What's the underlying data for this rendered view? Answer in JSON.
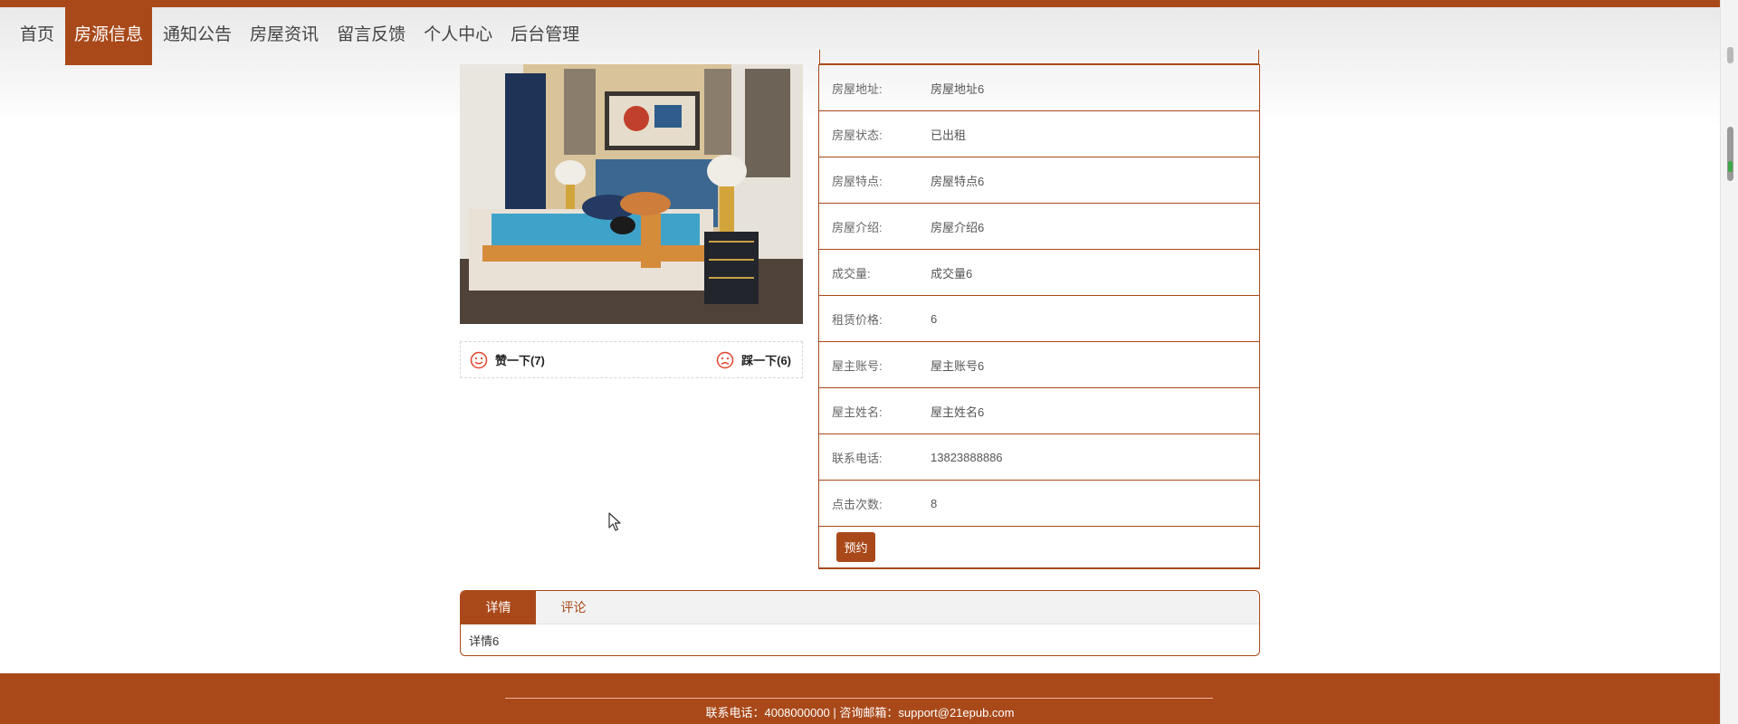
{
  "nav": {
    "items": [
      {
        "label": "首页",
        "active": false
      },
      {
        "label": "房源信息",
        "active": true
      },
      {
        "label": "通知公告",
        "active": false
      },
      {
        "label": "房屋资讯",
        "active": false
      },
      {
        "label": "留言反馈",
        "active": false
      },
      {
        "label": "个人中心",
        "active": false
      },
      {
        "label": "后台管理",
        "active": false
      }
    ]
  },
  "votes": {
    "like_label": "赞一下(7)",
    "dislike_label": "踩一下(6)"
  },
  "details": {
    "rows": [
      {
        "label": "房屋地址:",
        "value": "房屋地址6"
      },
      {
        "label": "房屋状态:",
        "value": "已出租"
      },
      {
        "label": "房屋特点:",
        "value": "房屋特点6"
      },
      {
        "label": "房屋介绍:",
        "value": "房屋介绍6"
      },
      {
        "label": "成交量:",
        "value": "成交量6"
      },
      {
        "label": "租赁价格:",
        "value": "6"
      },
      {
        "label": "屋主账号:",
        "value": "屋主账号6"
      },
      {
        "label": "屋主姓名:",
        "value": "屋主姓名6"
      },
      {
        "label": "联系电话:",
        "value": "13823888886"
      },
      {
        "label": "点击次数:",
        "value": "8"
      }
    ],
    "book_button": "预约"
  },
  "tabs": {
    "items": [
      "详情",
      "评论"
    ],
    "active_index": 0,
    "content": "详情6"
  },
  "footer": {
    "contact": "联系电话：4008000000 | 咨询邮箱：support@21epub.com"
  },
  "colors": {
    "accent": "#a9491a",
    "vote_icon": "#e0452e"
  }
}
